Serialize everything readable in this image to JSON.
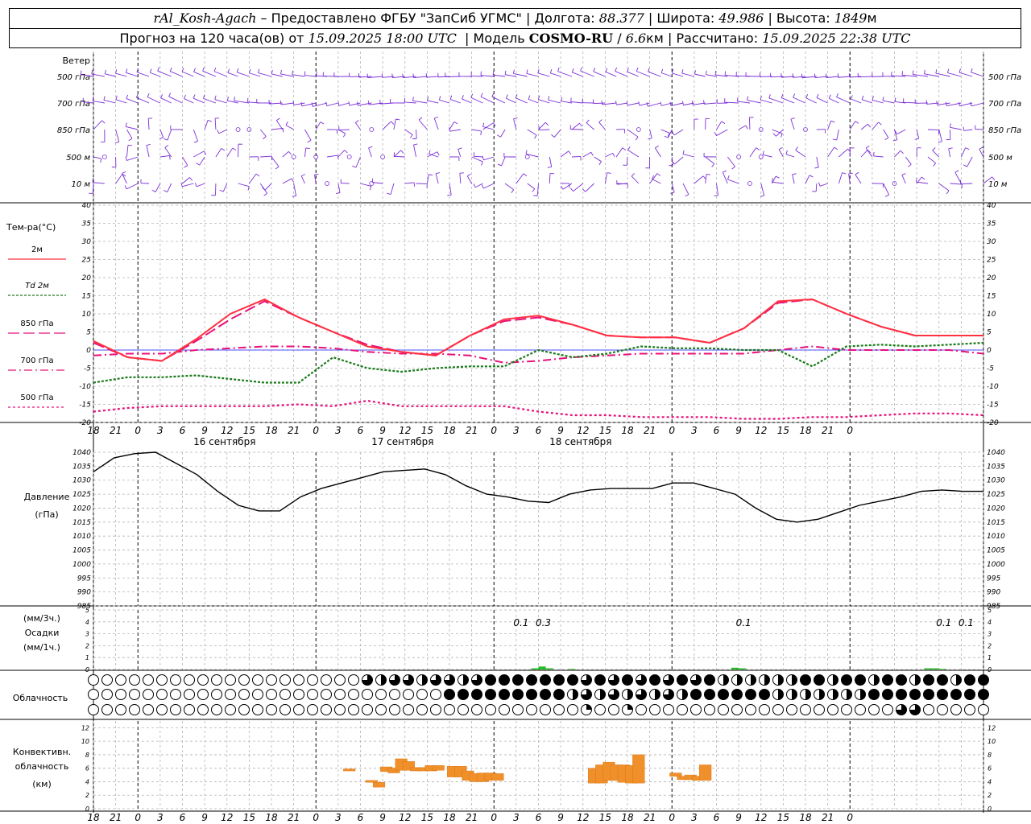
{
  "header": {
    "station": "rAl_Kosh-Agach",
    "dash": " –",
    "provider": "Предоставлено ФГБУ \"ЗапСиб УГМС\"",
    "lon_label": "Долгота:",
    "lon_value": "88.377",
    "lat_label": "Широта:",
    "lat_value": "49.986",
    "alt_label": "Высота:",
    "alt_value": "1849",
    "alt_unit": "м",
    "forecast_prefix": "Прогноз на 120 часа(ов) от",
    "forecast_time": "15.09.2025 18:00 UTC",
    "model_label": "Модель",
    "model_name": "COSMO-RU",
    "model_res_value": "6.6",
    "model_res_unit": "км",
    "calc_label": "Рассчитано:",
    "calc_time": "15.09.2025 22:38 UTC"
  },
  "labels": {
    "wind_title": "Ветер",
    "wind_levels": [
      "500 гПа",
      "700 гПа",
      "850 гПа",
      "500 м",
      "10 м"
    ],
    "temp_title": "Тем-ра(°C)",
    "temp_legend": [
      {
        "label": "2м",
        "color": "#ff3040",
        "dash": ""
      },
      {
        "label": "Td 2м",
        "color": "#1a7a1a",
        "dash": "3,2"
      },
      {
        "label": "850 гПа",
        "color": "#e8107a",
        "dash": "14,5"
      },
      {
        "label": "700 гПа",
        "color": "#e8107a",
        "dash": "10,4,2,4"
      },
      {
        "label": "500 гПа",
        "color": "#e8107a",
        "dash": "3,3"
      }
    ],
    "pressure_title": "Давление",
    "pressure_unit": "(гПа)",
    "precip_unit_top": "(мм/3ч.)",
    "precip_title": "Осадки",
    "precip_unit_bottom": "(мм/1ч.)",
    "cloud_title": "Облачность",
    "conv_title_1": "Конвективн.",
    "conv_title_2": "облачность",
    "conv_unit": "(км)",
    "day_labels": [
      "16 сентября",
      "17 сентября",
      "18 сентября"
    ]
  },
  "chart_data": [
    {
      "type": "barbs",
      "panel": "wind",
      "title": "Ветер",
      "levels": [
        "500 гПа",
        "700 гПа",
        "850 гПа",
        "500 м",
        "10 м"
      ]
    },
    {
      "type": "line",
      "panel": "temperature",
      "ylabel": "Тем-ра(°C)",
      "ylim": [
        -20,
        40
      ],
      "yticks": [
        -20,
        -15,
        -10,
        -5,
        0,
        5,
        10,
        15,
        20,
        25,
        30,
        35,
        40
      ],
      "x_hours": [
        0,
        6,
        12,
        18,
        24,
        30,
        36,
        42,
        48,
        54,
        60,
        66,
        72,
        78,
        84,
        90,
        96,
        102,
        108,
        114,
        120
      ],
      "xticks": [
        "18",
        "21",
        "0",
        "3",
        "6",
        "9",
        "12",
        "15",
        "18",
        "21",
        "0",
        "3",
        "6",
        "9",
        "12",
        "15",
        "18",
        "21",
        "0",
        "3",
        "6",
        "9",
        "12",
        "15",
        "18",
        "21",
        "0",
        "3",
        "6",
        "9",
        "12",
        "15",
        "18",
        "21",
        "0"
      ],
      "series": [
        {
          "name": "2м",
          "values": [
            2.5,
            -2,
            -3,
            3,
            10,
            14,
            9,
            5,
            1,
            -0.5,
            -1.5,
            4,
            8.5,
            9.5,
            7,
            4,
            3.5,
            3.5,
            2,
            6,
            13.5,
            14,
            10,
            6.5,
            4,
            4,
            4
          ]
        },
        {
          "name": "Td 2м",
          "values": [
            -9,
            -7.5,
            -7.5,
            -7,
            -8,
            -9,
            -9,
            -2,
            -5,
            -6,
            -5,
            -4.5,
            -4.5,
            0,
            -2,
            -1,
            1,
            0.5,
            0.5,
            0,
            0,
            -4.5,
            1,
            1.5,
            1,
            1.5,
            2
          ]
        },
        {
          "name": "850 гПа",
          "values": [
            2,
            -2,
            -3,
            2.5,
            8.5,
            13.5,
            9,
            5,
            1.5,
            -0.5,
            -1.5,
            4,
            8,
            9,
            7,
            4,
            3.5,
            3.5,
            2,
            6,
            13,
            14,
            10,
            6.5,
            4,
            4,
            4
          ]
        },
        {
          "name": "700 гПа",
          "values": [
            -1.5,
            -1,
            -1,
            0,
            0.5,
            1,
            1,
            0.5,
            -0.5,
            -1,
            -1,
            -1.5,
            -3.5,
            -3,
            -2,
            -1.5,
            -1,
            -1,
            -1,
            -1,
            0,
            1,
            0,
            0,
            0,
            0,
            -1
          ]
        },
        {
          "name": "500 гПа",
          "values": [
            -17,
            -16,
            -15.5,
            -15.5,
            -15.5,
            -15.5,
            -15,
            -15.5,
            -14,
            -15.5,
            -15.5,
            -15.5,
            -15.5,
            -17,
            -18,
            -18,
            -18.5,
            -18.5,
            -18.5,
            -19,
            -19,
            -18.5,
            -18.5,
            -18,
            -17.5,
            -17.5,
            -18
          ]
        }
      ]
    },
    {
      "type": "line",
      "panel": "pressure",
      "ylabel": "Давление (гПа)",
      "ylim": [
        985,
        1040
      ],
      "yticks": [
        985,
        990,
        995,
        1000,
        1005,
        1010,
        1015,
        1020,
        1025,
        1030,
        1035,
        1040
      ],
      "series": [
        {
          "name": "Давление",
          "values": [
            1033,
            1038,
            1039.5,
            1040,
            1036,
            1032,
            1026,
            1021,
            1019,
            1019,
            1024,
            1027,
            1029,
            1031,
            1033,
            1033.5,
            1034,
            1032,
            1028,
            1025,
            1024,
            1022.5,
            1022,
            1025,
            1026.5,
            1027,
            1027,
            1027,
            1029,
            1029,
            1027,
            1025,
            1020,
            1016,
            1015,
            1016,
            1018.5,
            1021,
            1022.5,
            1024,
            1026,
            1026.5,
            1026,
            1026
          ]
        }
      ]
    },
    {
      "type": "bar",
      "panel": "precipitation",
      "ylabel": "Осадки (мм/3ч.) / (мм/1ч.)",
      "ylim": [
        0,
        5
      ],
      "labels_3h": [
        {
          "hour": 57,
          "text": "0.1"
        },
        {
          "hour": 60,
          "text": "0.3"
        },
        {
          "hour": 87,
          "text": "0.1"
        },
        {
          "hour": 114,
          "text": "0.1"
        },
        {
          "hour": 117,
          "text": "0.1"
        }
      ]
    },
    {
      "type": "symbols",
      "panel": "cloudiness",
      "ylabel": "Облачность",
      "rows": 3
    },
    {
      "type": "bar",
      "panel": "convective",
      "ylabel": "Конвективн. облачность (км)",
      "ylim": [
        0,
        13
      ],
      "yticks": [
        0,
        2,
        4,
        6,
        8,
        10,
        12
      ],
      "bars": [
        {
          "hour": 34.5,
          "low": 5.6,
          "high": 5.9
        },
        {
          "hour": 37.5,
          "low": 3.9,
          "high": 4.2
        },
        {
          "hour": 38.5,
          "low": 3.2,
          "high": 3.9
        },
        {
          "hour": 39.5,
          "low": 5.5,
          "high": 6.2
        },
        {
          "hour": 40.5,
          "low": 5.3,
          "high": 6.0
        },
        {
          "hour": 41.5,
          "low": 5.7,
          "high": 7.4
        },
        {
          "hour": 42.5,
          "low": 5.7,
          "high": 7.0
        },
        {
          "hour": 43.5,
          "low": 5.6,
          "high": 6.1
        },
        {
          "hour": 44.5,
          "low": 5.6,
          "high": 6.1
        },
        {
          "hour": 45.5,
          "low": 5.6,
          "high": 6.4
        },
        {
          "hour": 46.5,
          "low": 5.7,
          "high": 6.4
        },
        {
          "hour": 48.5,
          "low": 4.7,
          "high": 6.3
        },
        {
          "hour": 49.5,
          "low": 4.7,
          "high": 6.3
        },
        {
          "hour": 50.5,
          "low": 4.2,
          "high": 5.6
        },
        {
          "hour": 51.5,
          "low": 4.0,
          "high": 5.2
        },
        {
          "hour": 52.5,
          "low": 4.0,
          "high": 5.3
        },
        {
          "hour": 53.5,
          "low": 4.2,
          "high": 5.3
        },
        {
          "hour": 54.5,
          "low": 4.2,
          "high": 5.2
        },
        {
          "hour": 67.5,
          "low": 3.8,
          "high": 6.0
        },
        {
          "hour": 68.5,
          "low": 3.8,
          "high": 6.5
        },
        {
          "hour": 69.5,
          "low": 4.2,
          "high": 6.9
        },
        {
          "hour": 70.5,
          "low": 4.2,
          "high": 6.5
        },
        {
          "hour": 71.5,
          "low": 3.9,
          "high": 6.5
        },
        {
          "hour": 72.5,
          "low": 3.8,
          "high": 6.4
        },
        {
          "hour": 73.5,
          "low": 3.8,
          "high": 8.0
        },
        {
          "hour": 78.5,
          "low": 4.8,
          "high": 5.3
        },
        {
          "hour": 79.5,
          "low": 4.3,
          "high": 4.8
        },
        {
          "hour": 80.5,
          "low": 4.3,
          "high": 5.0
        },
        {
          "hour": 81.5,
          "low": 4.2,
          "high": 4.8
        },
        {
          "hour": 82.5,
          "low": 4.2,
          "high": 6.5
        }
      ]
    }
  ]
}
